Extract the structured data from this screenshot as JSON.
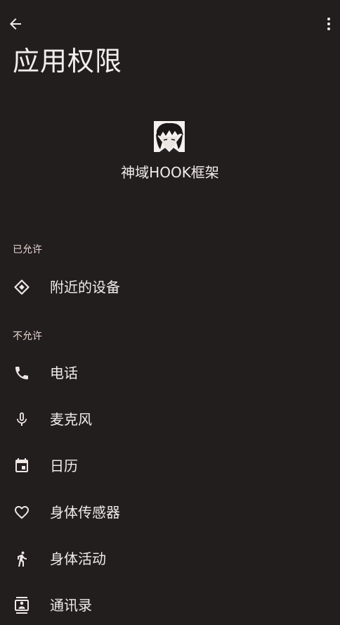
{
  "header": {
    "back_icon": "arrow-left-icon",
    "more_icon": "more-vert-icon",
    "title": "应用权限"
  },
  "app": {
    "name": "神域HOOK框架"
  },
  "sections": {
    "allowed": {
      "title": "已允许",
      "items": [
        {
          "label": "附近的设备",
          "icon": "nearby-devices-icon"
        }
      ]
    },
    "denied": {
      "title": "不允许",
      "items": [
        {
          "label": "电话",
          "icon": "phone-icon"
        },
        {
          "label": "麦克风",
          "icon": "microphone-icon"
        },
        {
          "label": "日历",
          "icon": "calendar-icon"
        },
        {
          "label": "身体传感器",
          "icon": "heart-icon"
        },
        {
          "label": "身体活动",
          "icon": "walking-icon"
        },
        {
          "label": "通讯录",
          "icon": "contacts-icon"
        }
      ]
    }
  },
  "colors": {
    "background": "#231e1e",
    "text_primary": "#f1ecea",
    "text_section": "#e5d6d0",
    "icon": "#efe7e4"
  }
}
